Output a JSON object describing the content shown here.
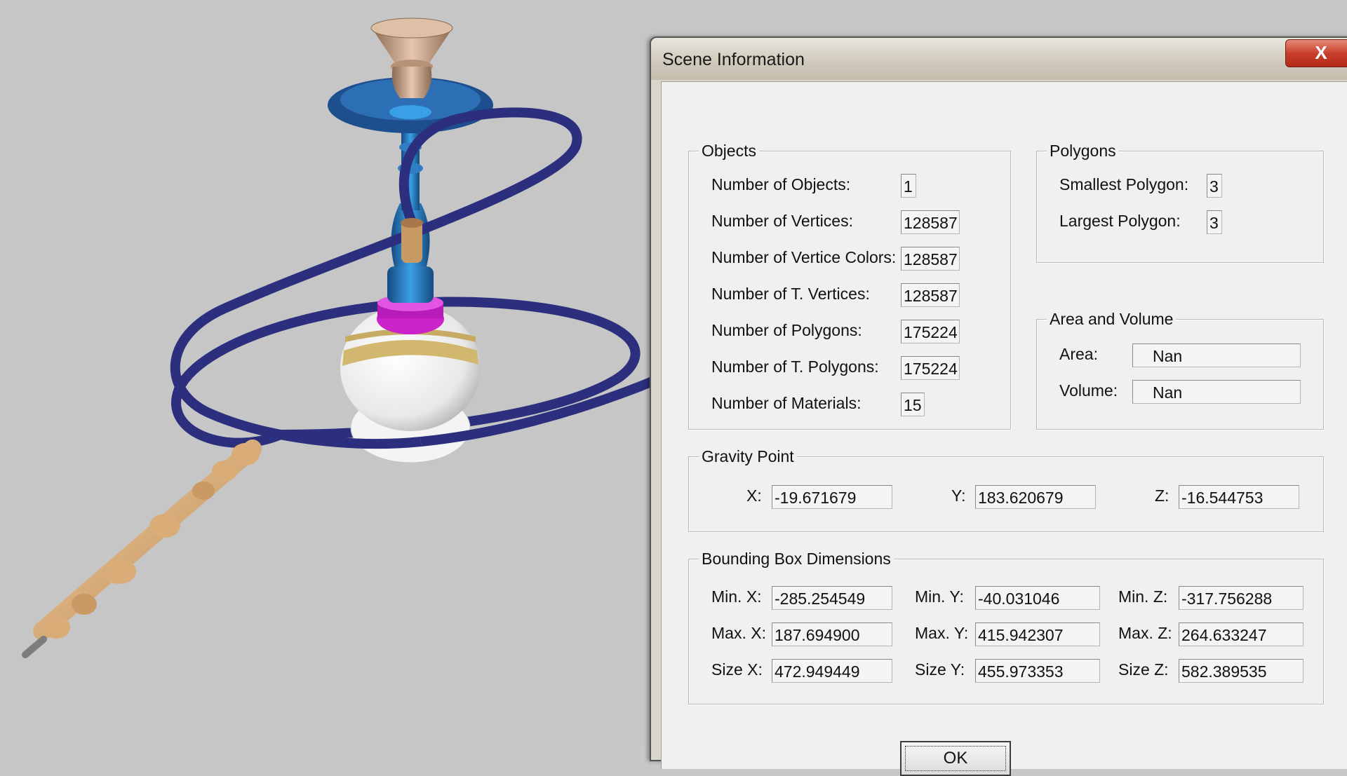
{
  "dialog": {
    "title": "Scene Information",
    "close_label": "X",
    "ok_label": "OK"
  },
  "objects": {
    "legend": "Objects",
    "rows": [
      {
        "label": "Number of Objects:",
        "value": "1"
      },
      {
        "label": "Number of Vertices:",
        "value": "128587"
      },
      {
        "label": "Number of Vertice Colors:",
        "value": "128587"
      },
      {
        "label": "Number of T. Vertices:",
        "value": "128587"
      },
      {
        "label": "Number of Polygons:",
        "value": "175224"
      },
      {
        "label": "Number of T. Polygons:",
        "value": "175224"
      },
      {
        "label": "Number of Materials:",
        "value": "15"
      }
    ]
  },
  "polygons": {
    "legend": "Polygons",
    "rows": [
      {
        "label": "Smallest Polygon:",
        "value": "3"
      },
      {
        "label": "Largest Polygon:",
        "value": "3"
      }
    ]
  },
  "area_volume": {
    "legend": "Area and Volume",
    "area_label": "Area:",
    "area_value": "Nan",
    "volume_label": "Volume:",
    "volume_value": "Nan"
  },
  "gravity": {
    "legend": "Gravity Point",
    "x_label": "X:",
    "x_value": "-19.671679",
    "y_label": "Y:",
    "y_value": "183.620679",
    "z_label": "Z:",
    "z_value": "-16.544753"
  },
  "bbox": {
    "legend": "Bounding Box Dimensions",
    "min_x_label": "Min. X:",
    "min_x": "-285.254549",
    "min_y_label": "Min. Y:",
    "min_y": "-40.031046",
    "min_z_label": "Min. Z:",
    "min_z": "-317.756288",
    "max_x_label": "Max. X:",
    "max_x": "187.694900",
    "max_y_label": "Max. Y:",
    "max_y": "415.942307",
    "max_z_label": "Max. Z:",
    "max_z": "264.633247",
    "size_x_label": "Size X:",
    "size_x": "472.949449",
    "size_y_label": "Size Y:",
    "size_y": "455.973353",
    "size_z_label": "Size Z:",
    "size_z": "582.389535"
  },
  "colors": {
    "viewport_bg": "#c6c6c6",
    "hose": "#2b2f7e",
    "stem": "#1f5f9e",
    "accent_magenta": "#cc22cc",
    "wood": "#d9ac78"
  }
}
